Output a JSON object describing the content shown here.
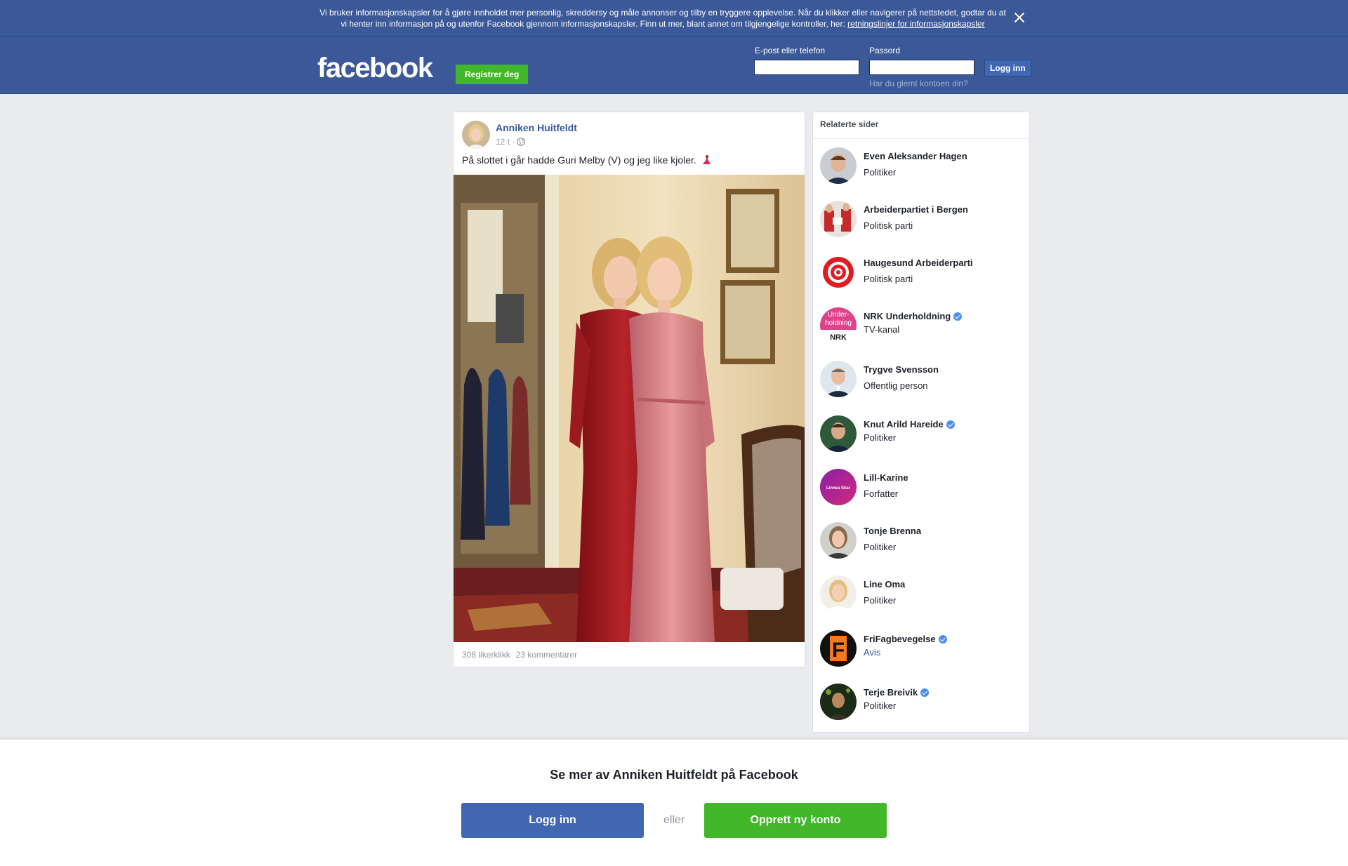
{
  "cookie_banner": {
    "text": "Vi bruker informasjonskapsler for å gjøre innholdet mer personlig, skreddersy og måle annonser og tilby en tryggere opplevelse. Når du klikker eller navigerer på nettstedet, godtar du at vi henter inn informasjon på og utenfor Facebook gjennom informasjonskapsler. Finn ut mer, blant annet om tilgjengelige kontroller, her: ",
    "link": "retningslinjer for informasjonskapsler",
    "close_icon": "close-icon"
  },
  "header": {
    "logo": "facebook",
    "register_label": "Registrer deg",
    "email_label": "E-post eller telefon",
    "email_value": "",
    "password_label": "Passord",
    "password_value": "",
    "login_label": "Logg inn",
    "forgot_label": "Har du glemt kontoen din?"
  },
  "post": {
    "author": "Anniken Huitfeldt",
    "time": "12 t ·",
    "privacy_icon": "globe-icon",
    "text": "På slottet i går hadde Guri Melby (V) og jeg like kjoler.",
    "emoji": "dancer-emoji",
    "likes": "308 likerklikk",
    "comments": "23 kommentarer"
  },
  "related": {
    "title": "Relaterte sider",
    "items": [
      {
        "name": "Even Aleksander Hagen",
        "category": "Politiker",
        "verified": false
      },
      {
        "name": "Arbeiderpartiet i Bergen",
        "category": "Politisk parti",
        "verified": false
      },
      {
        "name": "Haugesund Arbeiderparti",
        "category": "Politisk parti",
        "verified": false
      },
      {
        "name": "NRK Underholdning",
        "category": "TV-kanal",
        "verified": true
      },
      {
        "name": "Trygve Svensson",
        "category": "Offentlig person",
        "verified": false
      },
      {
        "name": "Knut Arild Hareide",
        "category": "Politiker",
        "verified": true
      },
      {
        "name": "Lill-Karine",
        "category": "Forfatter",
        "verified": false
      },
      {
        "name": "Tonje Brenna",
        "category": "Politiker",
        "verified": false
      },
      {
        "name": "Line Oma",
        "category": "Politiker",
        "verified": false
      },
      {
        "name": "FriFagbevegelse",
        "category": "Avis",
        "verified": true
      },
      {
        "name": "Terje Breivik",
        "category": "Politiker",
        "verified": true
      }
    ],
    "avatar_logo_texts": {
      "nrk_top": "Under-",
      "nrk_mid": "holdning",
      "nrk_bottom": "NRK",
      "lill_karine": "Linnea Skar",
      "frifag": "F"
    }
  },
  "bottom_sheet": {
    "title": "Se mer av Anniken Huitfeldt på Facebook",
    "login_label": "Logg inn",
    "or_label": "eller",
    "create_label": "Opprett ny konto"
  },
  "colors": {
    "brand_blue": "#3b5998",
    "button_blue": "#4267b2",
    "green": "#42b72a",
    "link": "#365899",
    "verified": "#4c8ff7"
  }
}
